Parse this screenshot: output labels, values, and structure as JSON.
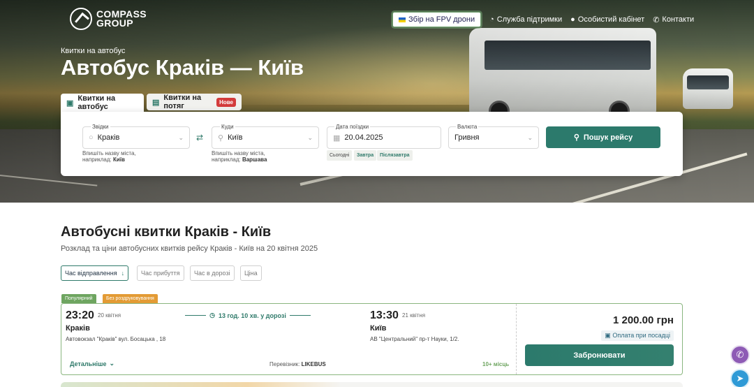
{
  "header": {
    "logo_line1": "COMPASS",
    "logo_line2": "GROUP",
    "fpv_button": "Збір на FPV дрони",
    "nav": [
      {
        "label": "Служба підтримки",
        "icon": "headset-icon"
      },
      {
        "label": "Особистий кабінет",
        "icon": "user-icon"
      },
      {
        "label": "Контакти",
        "icon": "phone-icon"
      }
    ]
  },
  "hero": {
    "kicker": "Квитки на автобус",
    "title": "Автобус Краків — Київ"
  },
  "tabs": [
    {
      "label": "Квитки на автобус",
      "icon": "bus-icon",
      "active": true
    },
    {
      "label": "Квитки на потяг",
      "icon": "train-icon",
      "active": false,
      "badge": "Нове"
    }
  ],
  "search": {
    "from": {
      "label": "Звідки",
      "value": "Краків",
      "hint_line1": "Впишіть назву міста,",
      "hint_prefix": "наприклад: ",
      "hint_example": "Київ"
    },
    "to": {
      "label": "Куди",
      "value": "Київ",
      "hint_line1": "Впишіть назву міста,",
      "hint_prefix": "наприклад: ",
      "hint_example": "Варшава"
    },
    "date": {
      "label": "Дата поїздки",
      "value": "20.04.2025",
      "quick": [
        "Сьогодні",
        "Завтра",
        "Післязавтра"
      ]
    },
    "currency": {
      "label": "Валюта",
      "value": "Гривня"
    },
    "submit": "Пошук рейсу"
  },
  "results": {
    "title": "Автобусні квитки Краків - Київ",
    "subtitle": "Розклад та ціни автобусних квитків рейсу Краків - Київ на 20 квітня 2025",
    "sort": [
      {
        "label": "Час відправлення",
        "active": true,
        "arrow": "↓"
      },
      {
        "label": "Час прибуття",
        "active": false
      },
      {
        "label": "Час в дорозі",
        "active": false
      },
      {
        "label": "Ціна",
        "active": false
      }
    ],
    "trip": {
      "tags": [
        "Популярний",
        "Без роздруковування"
      ],
      "dep_time": "23:20",
      "dep_date": "20 квітня",
      "dep_city": "Краків",
      "dep_addr": "Автовокзал \"Краків\" вул. Босацька , 18",
      "duration": "13 год. 10 хв. у дорозі",
      "arr_time": "13:30",
      "arr_date": "21 квітня",
      "arr_city": "Київ",
      "arr_addr": "АВ \"Центральний\" пр-т Науки, 1/2.",
      "details": "Детальніше",
      "carrier_label": "Перевізник: ",
      "carrier": "LIKEBUS",
      "seats": "10+ місць",
      "price": "1 200.00 грн",
      "payment": "Оплата при посадці",
      "book": "Забронювати"
    }
  },
  "colors": {
    "accent": "#2c7a6c",
    "popular": "#6ea560",
    "no_print": "#e39b35",
    "new_badge": "#d33b3b"
  }
}
